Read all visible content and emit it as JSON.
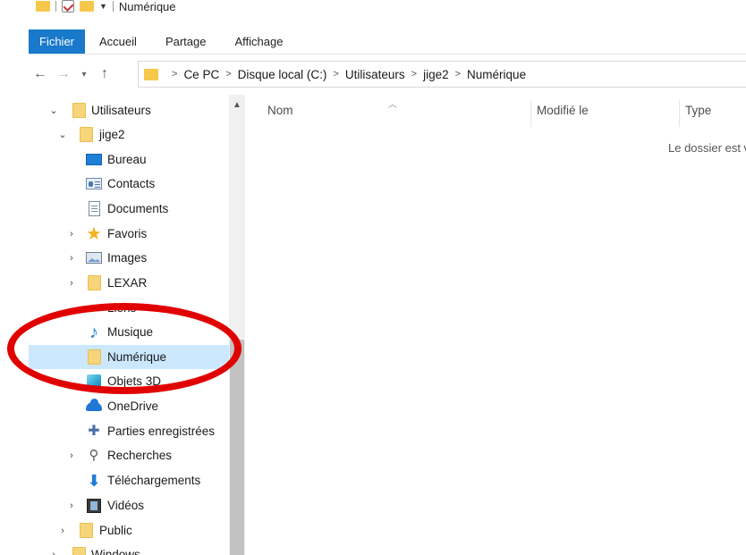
{
  "window": {
    "title": "Numérique"
  },
  "ribbon": {
    "tabs": [
      {
        "label": "Fichier",
        "active": true
      },
      {
        "label": "Accueil"
      },
      {
        "label": "Partage"
      },
      {
        "label": "Affichage"
      }
    ]
  },
  "address": {
    "crumbs": [
      "Ce PC",
      "Disque local (C:)",
      "Utilisateurs",
      "jige2",
      "Numérique"
    ]
  },
  "nav": {
    "items": [
      {
        "label": "Utilisateurs",
        "icon": "folder-icon",
        "level": 0,
        "expanded": true
      },
      {
        "label": "jige2",
        "icon": "folder-icon",
        "level": 1,
        "expanded": true
      },
      {
        "label": "Bureau",
        "icon": "desktop-icon",
        "level": 2
      },
      {
        "label": "Contacts",
        "icon": "contacts-icon",
        "level": 2
      },
      {
        "label": "Documents",
        "icon": "documents-icon",
        "level": 2
      },
      {
        "label": "Favoris",
        "icon": "star-icon",
        "level": 2,
        "expandable": true
      },
      {
        "label": "Images",
        "icon": "images-icon",
        "level": 2,
        "expandable": true
      },
      {
        "label": "LEXAR",
        "icon": "folder-icon",
        "level": 2,
        "expandable": true
      },
      {
        "label": "Liens",
        "icon": "link-icon",
        "level": 2
      },
      {
        "label": "Musique",
        "icon": "music-icon",
        "level": 2
      },
      {
        "label": "Numérique",
        "icon": "folder-icon",
        "level": 2,
        "selected": true
      },
      {
        "label": "Objets 3D",
        "icon": "cube-3d-icon",
        "level": 2
      },
      {
        "label": "OneDrive",
        "icon": "onedrive-icon",
        "level": 2
      },
      {
        "label": "Parties enregistrées",
        "icon": "saved-games-icon",
        "level": 2
      },
      {
        "label": "Recherches",
        "icon": "search-icon",
        "level": 2,
        "expandable": true
      },
      {
        "label": "Téléchargements",
        "icon": "download-icon",
        "level": 2
      },
      {
        "label": "Vidéos",
        "icon": "video-icon",
        "level": 2,
        "expandable": true
      },
      {
        "label": "Public",
        "icon": "folder-icon",
        "level": 1,
        "expandable": true
      },
      {
        "label": "Windows",
        "icon": "folder-icon",
        "level": 0,
        "expandable": true
      }
    ]
  },
  "content": {
    "columns": [
      "Nom",
      "Modifié le",
      "Type"
    ],
    "empty_message": "Le dossier est vide."
  },
  "colors": {
    "accent": "#1979ca",
    "selection": "#cce8ff",
    "annotation": "#e10000"
  }
}
